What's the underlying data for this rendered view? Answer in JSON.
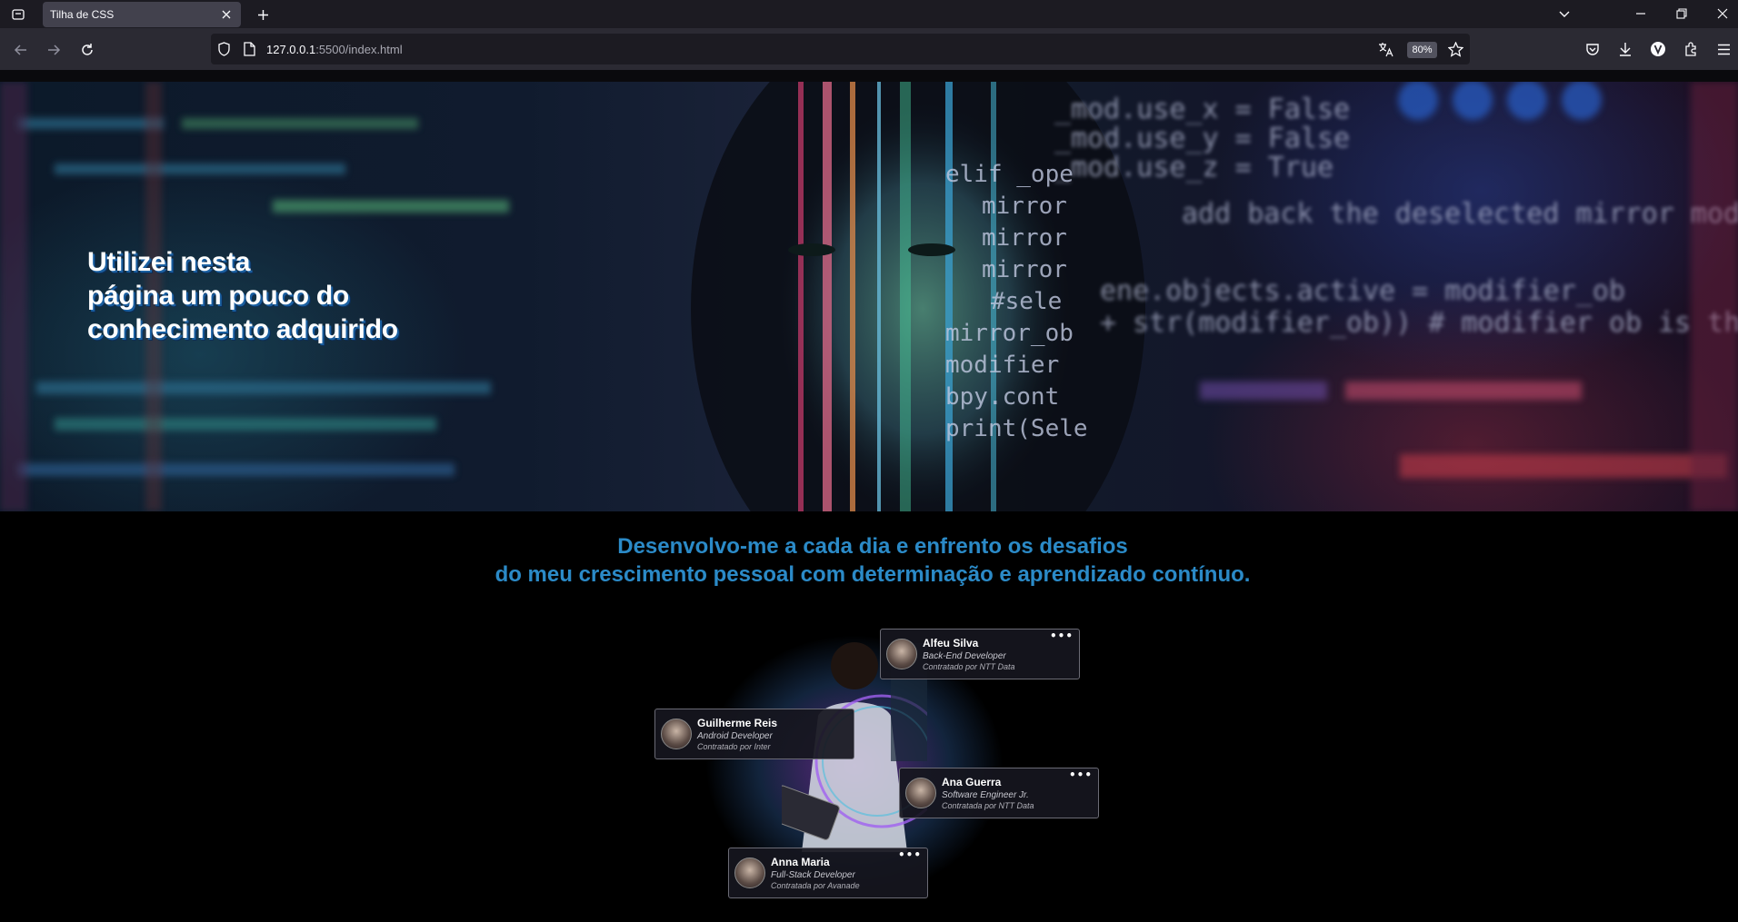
{
  "browser": {
    "tab_title": "Tilha de CSS",
    "url_host": "127.0.0.1",
    "url_rest": ":5500/index.html",
    "zoom": "80%"
  },
  "hero": {
    "lines": [
      "Utilizei nesta",
      "página um pouco do",
      "conhecimento adquirido"
    ]
  },
  "tagline": {
    "line1": "Desenvolvo-me a cada dia e enfrento os desafios",
    "line2": "do meu crescimento pessoal com determinação e aprendizado contínuo."
  },
  "cards": [
    {
      "name": "Alfeu Silva",
      "role": "Back-End Developer",
      "company": "Contratado por NTT Data",
      "more": "•••"
    },
    {
      "name": "Guilherme Reis",
      "role": "Android Developer",
      "company": "Contratado por Inter",
      "more": ""
    },
    {
      "name": "Ana Guerra",
      "role": "Software Engineer Jr.",
      "company": "Contratada por NTT Data",
      "more": "•••"
    },
    {
      "name": "Anna Maria",
      "role": "Full-Stack Developer",
      "company": "Contratada por Avanade",
      "more": "•••"
    }
  ],
  "colors": {
    "accent": "#2b8ac7",
    "chrome_bg": "#2b2a33",
    "tabbar_bg": "#1c1b22"
  }
}
